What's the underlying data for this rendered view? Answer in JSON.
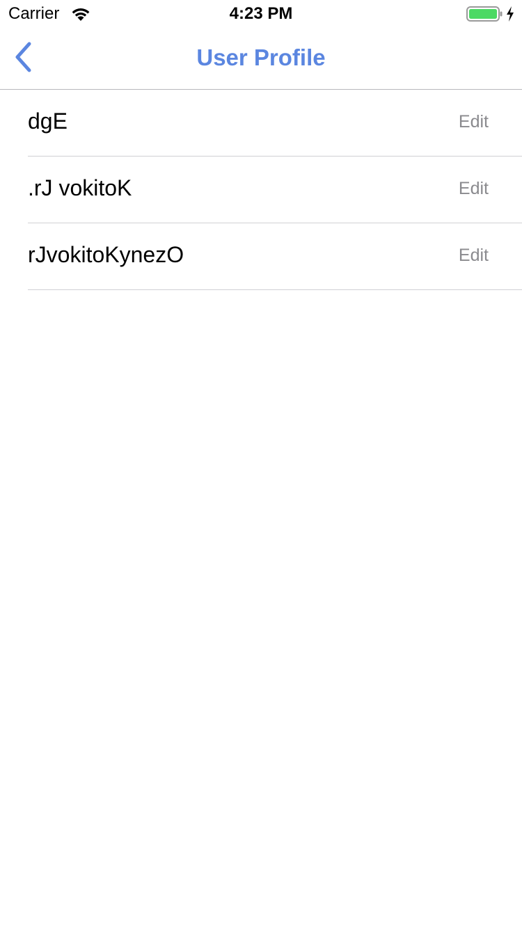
{
  "status_bar": {
    "carrier": "Carrier",
    "time": "4:23 PM",
    "battery_color": "#4cd964"
  },
  "nav": {
    "title": "User Profile",
    "accent_color": "#5b86e0",
    "back_icon": "chevron-left-icon"
  },
  "profile_rows": [
    {
      "value": "dgE",
      "action": "Edit"
    },
    {
      "value": ".rJ vokitoK",
      "action": "Edit"
    },
    {
      "value": "rJvokitoKynezO",
      "action": "Edit"
    }
  ]
}
